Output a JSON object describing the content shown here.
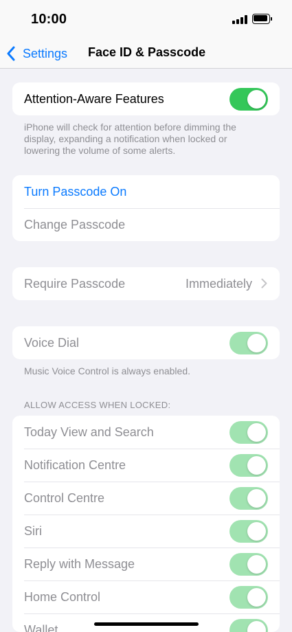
{
  "status": {
    "time": "10:00"
  },
  "nav": {
    "back_label": "Settings",
    "title": "Face ID & Passcode"
  },
  "attention": {
    "label": "Attention-Aware Features",
    "enabled": true,
    "footer": "iPhone will check for attention before dimming the display, expanding a notification when locked or lowering the volume of some alerts."
  },
  "passcode": {
    "turn_on_label": "Turn Passcode On",
    "change_label": "Change Passcode"
  },
  "require": {
    "label": "Require Passcode",
    "value": "Immediately"
  },
  "voice_dial": {
    "label": "Voice Dial",
    "enabled": true,
    "footer": "Music Voice Control is always enabled."
  },
  "locked_access": {
    "header": "ALLOW ACCESS WHEN LOCKED:",
    "items": [
      {
        "label": "Today View and Search",
        "enabled": true
      },
      {
        "label": "Notification Centre",
        "enabled": true
      },
      {
        "label": "Control Centre",
        "enabled": true
      },
      {
        "label": "Siri",
        "enabled": true
      },
      {
        "label": "Reply with Message",
        "enabled": true
      },
      {
        "label": "Home Control",
        "enabled": true
      },
      {
        "label": "Wallet",
        "enabled": true
      }
    ]
  },
  "colors": {
    "accent": "#0a7aff",
    "toggle_on": "#34c759",
    "toggle_disabled": "#a1e3b1",
    "secondary_text": "#8e8e93"
  }
}
